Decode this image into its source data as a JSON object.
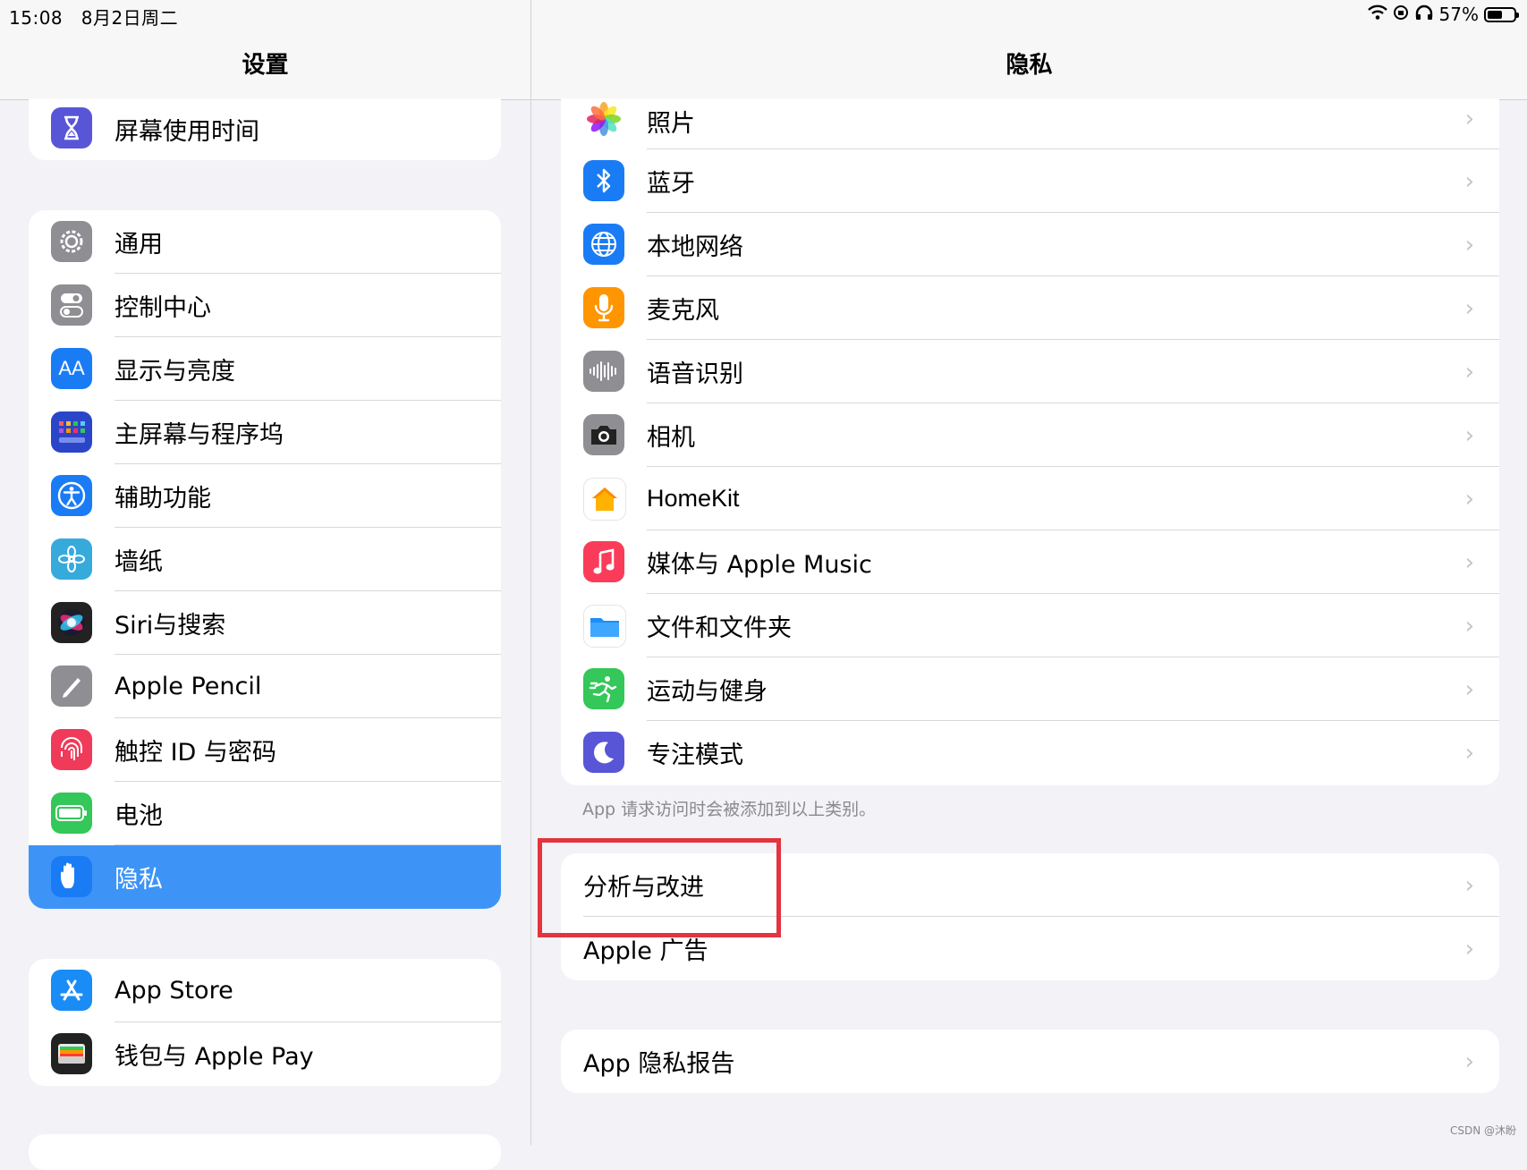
{
  "statusbar": {
    "time": "15:08",
    "date": "8月2日周二",
    "battery_percent": "57%",
    "battery_level": 0.57
  },
  "sidebar": {
    "title": "设置",
    "group1": [
      {
        "label": "屏幕使用时间",
        "icon": "hourglass-icon",
        "color": "#5856d6"
      }
    ],
    "group2": [
      {
        "label": "通用",
        "icon": "gear-icon",
        "color": "#8e8e93"
      },
      {
        "label": "控制中心",
        "icon": "toggles-icon",
        "color": "#8e8e93"
      },
      {
        "label": "显示与亮度",
        "icon": "text-size-icon",
        "color": "#1a7cf5"
      },
      {
        "label": "主屏幕与程序坞",
        "icon": "home-grid-icon",
        "color": "#2b45c9"
      },
      {
        "label": "辅助功能",
        "icon": "accessibility-icon",
        "color": "#1a7cf5"
      },
      {
        "label": "墙纸",
        "icon": "flower-icon",
        "color": "#37aadc"
      },
      {
        "label": "Siri与搜索",
        "icon": "siri-icon",
        "color": "#222222"
      },
      {
        "label": "Apple Pencil",
        "icon": "pencil-icon",
        "color": "#8e8e93"
      },
      {
        "label": "触控 ID 与密码",
        "icon": "fingerprint-icon",
        "color": "#f03a5a"
      },
      {
        "label": "电池",
        "icon": "battery-icon",
        "color": "#34c759"
      },
      {
        "label": "隐私",
        "icon": "hand-icon",
        "color": "#1a7cf5"
      }
    ],
    "group3": [
      {
        "label": "App Store",
        "icon": "app-store-icon",
        "color": "#1a8cf5"
      },
      {
        "label": "钱包与 Apple Pay",
        "icon": "wallet-icon",
        "color": "#222222"
      }
    ]
  },
  "detail": {
    "title": "隐私",
    "items": [
      {
        "label": "照片",
        "icon": "photos-icon",
        "color": "#ffffff"
      },
      {
        "label": "蓝牙",
        "icon": "bluetooth-icon",
        "color": "#1a7cf5"
      },
      {
        "label": "本地网络",
        "icon": "globe-icon",
        "color": "#1a7cf5"
      },
      {
        "label": "麦克风",
        "icon": "microphone-icon",
        "color": "#ff9500"
      },
      {
        "label": "语音识别",
        "icon": "waveform-icon",
        "color": "#8e8e93"
      },
      {
        "label": "相机",
        "icon": "camera-icon",
        "color": "#8e8e93"
      },
      {
        "label": "HomeKit",
        "icon": "home-icon",
        "color": "#ffffff"
      },
      {
        "label": "媒体与 Apple Music",
        "icon": "music-icon",
        "color": "#fa3c5a"
      },
      {
        "label": "文件和文件夹",
        "icon": "folder-icon",
        "color": "#ffffff"
      },
      {
        "label": "运动与健身",
        "icon": "runner-icon",
        "color": "#34c759"
      },
      {
        "label": "专注模式",
        "icon": "moon-icon",
        "color": "#5856d6"
      }
    ],
    "footnote": "App 请求访问时会被添加到以上类别。",
    "group2": [
      {
        "label": "分析与改进"
      },
      {
        "label": "Apple 广告"
      }
    ],
    "group3": [
      {
        "label": "App 隐私报告"
      }
    ]
  },
  "watermark": "CSDN @沐盼",
  "highlight_color": "#e3343f",
  "selected_color": "#3d94f6"
}
